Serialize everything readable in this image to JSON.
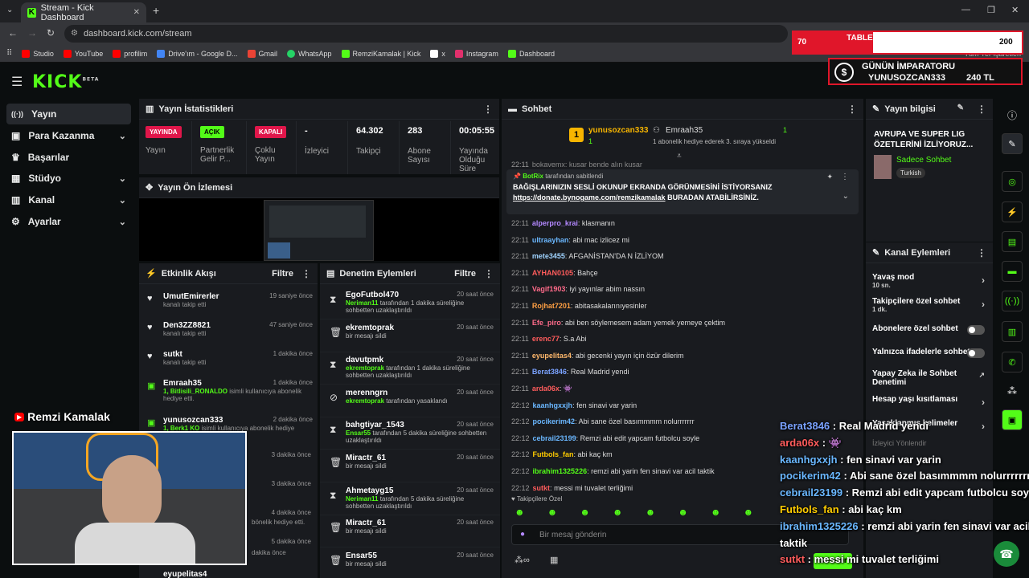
{
  "browser": {
    "tab_title": "Stream - Kick Dashboard",
    "url": "dashboard.kick.com/stream",
    "bookmarks": [
      {
        "label": "Studio",
        "color": "#ff0000"
      },
      {
        "label": "YouTube",
        "color": "#ff0000"
      },
      {
        "label": "profilim",
        "color": "#ff0000"
      },
      {
        "label": "Drive'ım - Google D...",
        "color": "#4285f4"
      },
      {
        "label": "Gmail",
        "color": "#ea4335"
      },
      {
        "label": "WhatsApp",
        "color": "#25d366"
      },
      {
        "label": "RemziKamalak | Kick",
        "color": "#53fc18"
      },
      {
        "label": "x",
        "color": "#ffffff"
      },
      {
        "label": "Instagram",
        "color": "#e1306c"
      },
      {
        "label": "Dashboard",
        "color": "#53fc18"
      }
    ],
    "all_bookmarks": "Tüm Yer İşaretleri"
  },
  "app": {
    "logo": "KICK",
    "logo_sup": "BETA",
    "accent": "#53fc18",
    "nav": [
      {
        "label": "Yayın",
        "icon": "broadcast-icon",
        "glyph": "((·))",
        "active": true
      },
      {
        "label": "Para Kazanma",
        "icon": "money-icon",
        "glyph": "▣",
        "chevron": "⌄"
      },
      {
        "label": "Başarılar",
        "icon": "trophy-icon",
        "glyph": "🏆",
        "chevron": ""
      },
      {
        "label": "Stüdyo",
        "icon": "studio-icon",
        "glyph": "▦",
        "chevron": "⌄"
      },
      {
        "label": "Kanal",
        "icon": "channel-icon",
        "glyph": "▥",
        "chevron": "⌄"
      },
      {
        "label": "Ayarlar",
        "icon": "gear-icon",
        "glyph": "⚙",
        "chevron": "⌄"
      }
    ]
  },
  "stats": {
    "title": "Yayın İstatistikleri",
    "items": [
      {
        "badge": "YAYINDA",
        "label": "Yayın",
        "badge_bg": "#e0164a",
        "badge_fg": "#fff"
      },
      {
        "badge": "AÇIK",
        "label": "Partnerlik Gelir P...",
        "badge_bg": "#53fc18",
        "badge_fg": "#000"
      },
      {
        "badge": "KAPALI",
        "label": "Çoklu Yayın",
        "badge_bg": "#e0164a",
        "badge_fg": "#fff"
      },
      {
        "value": "-",
        "label": "İzleyici"
      },
      {
        "value": "64.302",
        "label": "Takipçi"
      },
      {
        "value": "283",
        "label": "Abone Sayısı"
      },
      {
        "value": "00:05:55",
        "label": "Yayında Olduğu Süre"
      }
    ]
  },
  "preview": {
    "title": "Yayın Ön İzlemesi"
  },
  "activity": {
    "title": "Etkinlik Akışı",
    "filter": "Filtre",
    "items": [
      {
        "icon": "heart-icon",
        "glyph": "♥",
        "name": "UmutEmirerler",
        "sub": "kanalı takip etti",
        "time": "19 saniye önce"
      },
      {
        "icon": "heart-icon",
        "glyph": "♥",
        "name": "Den3ZZ8821",
        "sub": "kanalı takip etti",
        "time": "47 saniye önce"
      },
      {
        "icon": "heart-icon",
        "glyph": "♥",
        "name": "sutkt",
        "sub": "kanalı takip etti",
        "time": "1 dakika önce"
      },
      {
        "icon": "gift-icon",
        "glyph": "▣",
        "name": "Emraah35",
        "sub_hl": "1, Bitlisili_RONALDO",
        "sub": "isimli kullanıcıya abonelik hediye etti.",
        "time": "1 dakika önce"
      },
      {
        "icon": "gift-icon",
        "glyph": "▣",
        "name": "yunusozcan333",
        "sub_hl": "1, Berk1 KO",
        "sub": "isimli kullanıcıya abonelik hediye",
        "time": "2 dakika önce"
      }
    ],
    "extra_times": [
      "3 dakika önce",
      "3 dakika önce",
      "4 dakika önce",
      "5 dakika önce"
    ],
    "extra_texts": [
      "bönelik hediye etti.",
      "dakika önce"
    ],
    "cut_text": "eyupelitas4"
  },
  "moderation": {
    "title": "Denetim Eylemleri",
    "filter": "Filtre",
    "items": [
      {
        "icon": "hourglass-icon",
        "glyph": "⧗",
        "name": "EgoFutbol470",
        "actor": "Neriman11",
        "desc": "tarafından 1 dakika süreliğine sohbetten uzaklaştırıldı",
        "time": "20 saat önce"
      },
      {
        "icon": "trash-icon",
        "glyph": "🗑",
        "name": "ekremtoprak",
        "actor": "",
        "desc": "bir mesajı sildi",
        "time": "20 saat önce"
      },
      {
        "icon": "hourglass-icon",
        "glyph": "⧗",
        "name": "davutpmk",
        "actor": "ekremtoprak",
        "desc": "tarafından 1 dakika süreliğine sohbetten uzaklaştırıldı",
        "time": "20 saat önce"
      },
      {
        "icon": "ban-icon",
        "glyph": "⊘",
        "name": "merenngrn",
        "actor": "ekremtoprak",
        "desc": "tarafından yasaklandı",
        "time": "20 saat önce"
      },
      {
        "icon": "hourglass-icon",
        "glyph": "⧗",
        "name": "bahgtiyar_1543",
        "actor": "Ensar55",
        "desc": "tarafından 5 dakika süreliğine sohbetten uzaklaştırıldı",
        "time": "20 saat önce"
      },
      {
        "icon": "trash-icon",
        "glyph": "🗑",
        "name": "Miractr_61",
        "actor": "",
        "desc": "bir mesajı sildi",
        "time": "20 saat önce"
      },
      {
        "icon": "hourglass-icon",
        "glyph": "⧗",
        "name": "Ahmetayg15",
        "actor": "Neriman11",
        "desc": "tarafından 5 dakika süreliğine sohbetten uzaklaştırıldı",
        "time": "20 saat önce"
      },
      {
        "icon": "trash-icon",
        "glyph": "🗑",
        "name": "Miractr_61",
        "actor": "",
        "desc": "bir mesajı sildi",
        "time": "20 saat önce"
      },
      {
        "icon": "trash-icon",
        "glyph": "🗑",
        "name": "Ensar55",
        "actor": "",
        "desc": "bir mesajı sildi",
        "time": "20 saat önce"
      }
    ]
  },
  "chat": {
    "title": "Sohbet",
    "top_gifter": {
      "name": "yunusozcan333",
      "count": "1",
      "rank": "1"
    },
    "second": {
      "name": "Emraah35",
      "count": "1",
      "info": "1 abonelik hediye ederek 3. sıraya yükseldi"
    },
    "cut_line": "bokavemx: kusar bende alın kusar",
    "pinned": {
      "by_name": "BotRix",
      "by_text": "tarafından sabitlendi",
      "text": "BAĞIŞLARINIZIN SESLİ OKUNUP EKRANDA GÖRÜNMESİNİ İSTİYORSANIZ",
      "link": "https://donate.bynogame.com/remzikamalak",
      "after": "BURADAN ATABİLİRSİNİZ."
    },
    "messages": [
      {
        "time": "22:11",
        "user": "alperpro_krai",
        "color": "#b388ff",
        "text": "klasmanın"
      },
      {
        "time": "22:11",
        "user": "ultraayhan",
        "color": "#6ab7ff",
        "text": "abi mac izlicez mi"
      },
      {
        "time": "22:11",
        "user": "mete3455",
        "color": "#9fd3ff",
        "text": "AFGANİSTAN'DA N İZLİYOM"
      },
      {
        "time": "22:11",
        "user": "AYHAN0105",
        "color": "#ff5c5c",
        "text": "Bahçe"
      },
      {
        "time": "22:11",
        "user": "Vagif1903",
        "color": "#ff6b8a",
        "text": "iyi yayınlar abim nassın"
      },
      {
        "time": "22:11",
        "user": "Rojhat7201",
        "color": "#ff9f43",
        "text": "abitasakalarınıyesinler"
      },
      {
        "time": "22:11",
        "user": "Efe_piro",
        "color": "#ff6b8a",
        "text": "abi ben söylemesem adam yemek yemeye çektim"
      },
      {
        "time": "22:11",
        "user": "erenc77",
        "color": "#ff5c5c",
        "text": "S.a Abi"
      },
      {
        "time": "22:11",
        "user": "eyupelitas4",
        "color": "#ffb86c",
        "text": "abi gecenki yayın için özür dilerim"
      },
      {
        "time": "22:11",
        "user": "Berat3846",
        "color": "#7aa2ff",
        "text": "Real Madrid yendi"
      },
      {
        "time": "22:11",
        "user": "arda06x",
        "color": "#ff5c5c",
        "text": "👾"
      },
      {
        "time": "22:12",
        "user": "kaanhgxxjh",
        "color": "#6ab7ff",
        "text": "fen sinavi var yarin"
      },
      {
        "time": "22:12",
        "user": "pocikerim42",
        "color": "#6ab7ff",
        "text": "Abi sane özel basımmmm nolurrrrrrr"
      },
      {
        "time": "22:12",
        "user": "cebrail23199",
        "color": "#6ab7ff",
        "text": "Remzi abi edit yapcam futbolcu soyle"
      },
      {
        "time": "22:12",
        "user": "Futbols_fan",
        "color": "#ffcc00",
        "text": "abi kaç km"
      },
      {
        "time": "22:12",
        "user": "ibrahim1325226",
        "color": "#53fc18",
        "text": "remzi abi yarin fen sinavi var acil taktik"
      },
      {
        "time": "22:12",
        "user": "sutkt",
        "color": "#ff5c5c",
        "text": "messi mi tuvalet terliğimi"
      }
    ],
    "followers_only": "Takipçilere Özel",
    "placeholder": "Bir mesaj gönderin",
    "send": "Gönder"
  },
  "info": {
    "title": "Yayın bilgisi",
    "stream_title": "AVRUPA VE SUPER LIG ÖZETLERİNİ İZLİYORUZ...",
    "category": "Sadece Sohbet",
    "language": "Turkish"
  },
  "actions": {
    "title": "Kanal Eylemleri",
    "items": [
      {
        "label": "Yavaş mod",
        "sub": "10 sn.",
        "type": "arrow"
      },
      {
        "label": "Takipçilere özel sohbet",
        "sub": "1 dk.",
        "type": "arrow"
      },
      {
        "label": "Abonelere özel sohbet",
        "sub": "",
        "type": "toggle"
      },
      {
        "label": "Yalnızca ifadelerle sohbet",
        "sub": "",
        "type": "toggle"
      },
      {
        "label": "Yapay Zeka ile Sohbet Denetimi",
        "sub": "",
        "type": "external"
      },
      {
        "label": "Hesap yaşı kısıtlaması",
        "sub": "",
        "type": "arrow"
      },
      {
        "label": "Yasaklanmış kelimeler",
        "sub": "",
        "type": "arrow"
      },
      {
        "label": "İzleyici Yönlendir",
        "sub": "",
        "type": "none"
      }
    ]
  },
  "overlay": {
    "goal_current": "70",
    "goal_text": "TABLET DEĞİŞİMİ İÇİN ABONE HEDEFİMİZ",
    "goal_target": "200",
    "goal_progress": 0.35,
    "emperor_label": "GÜNÜN İMPARATORU",
    "emperor_name": "YUNUSOZCAN333",
    "emperor_amount": "240 TL",
    "youtube_name": "Remzi Kamalak",
    "chat_overlay": [
      {
        "user": "Berat3846",
        "text": "Real Madrid yendi",
        "color": "#7aa2ff"
      },
      {
        "user": "arda06x",
        "text": "👾",
        "color": "#ff5c5c"
      },
      {
        "user": "kaanhgxxjh",
        "text": "fen sinavi var yarin",
        "color": "#6ab7ff"
      },
      {
        "user": "pocikerim42",
        "text": "Abi sane özel basımmmm nolurrrrrrr",
        "color": "#6ab7ff"
      },
      {
        "user": "cebrail23199",
        "text": "Remzi abi edit yapcam futbolcu soyle",
        "color": "#6ab7ff"
      },
      {
        "user": "Futbols_fan",
        "text": "abi kaç km",
        "color": "#ffcc00"
      },
      {
        "user": "ibrahim1325226",
        "text": "remzi abi yarin fen sinavi var acil",
        "color": "#6ab7ff"
      },
      {
        "user": "",
        "text": "taktik",
        "color": "#fff"
      },
      {
        "user": "sutkt",
        "text": "messi mi tuvalet terliğimi",
        "color": "#ff5c5c"
      }
    ]
  }
}
